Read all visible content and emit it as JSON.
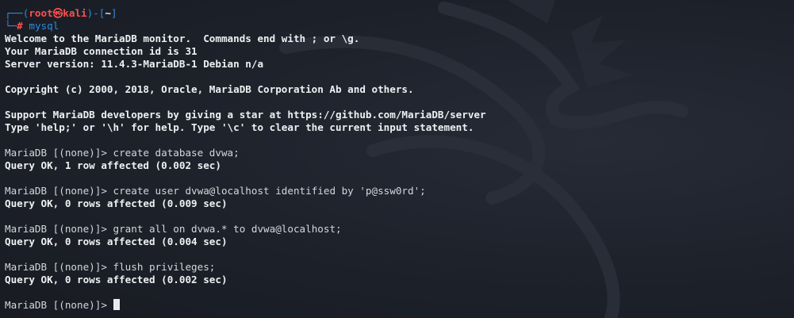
{
  "shell_prompt": {
    "frame_open": "┌──(",
    "user": "root",
    "skull": "㉿",
    "host": "kali",
    "frame_mid": ")-[",
    "cwd": "~",
    "frame_close": "]",
    "frame_bottom": "└─",
    "hash": "#",
    "command": "mysql"
  },
  "banner": {
    "line1": "Welcome to the MariaDB monitor.  Commands end with ; or \\g.",
    "line2": "Your MariaDB connection id is 31",
    "line3": "Server version: 11.4.3-MariaDB-1 Debian n/a",
    "copyright": "Copyright (c) 2000, 2018, Oracle, MariaDB Corporation Ab and others.",
    "support": "Support MariaDB developers by giving a star at https://github.com/MariaDB/server",
    "help": "Type 'help;' or '\\h' for help. Type '\\c' to clear the current input statement."
  },
  "session": [
    {
      "prompt": "MariaDB [(none)]> ",
      "command": "create database dvwa;",
      "result": "Query OK, 1 row affected (0.002 sec)"
    },
    {
      "prompt": "MariaDB [(none)]> ",
      "command": "create user dvwa@localhost identified by 'p@ssw0rd';",
      "result": "Query OK, 0 rows affected (0.009 sec)"
    },
    {
      "prompt": "MariaDB [(none)]> ",
      "command": "grant all on dvwa.* to dvwa@localhost;",
      "result": "Query OK, 0 rows affected (0.004 sec)"
    },
    {
      "prompt": "MariaDB [(none)]> ",
      "command": "flush privileges;",
      "result": "Query OK, 0 rows affected (0.002 sec)"
    }
  ],
  "current_prompt": "MariaDB [(none)]> ",
  "colors": {
    "background": "#1c2029",
    "frame_blue": "#2f8ae0",
    "root_red": "#ff4f4f",
    "text": "#d3d7dc"
  }
}
